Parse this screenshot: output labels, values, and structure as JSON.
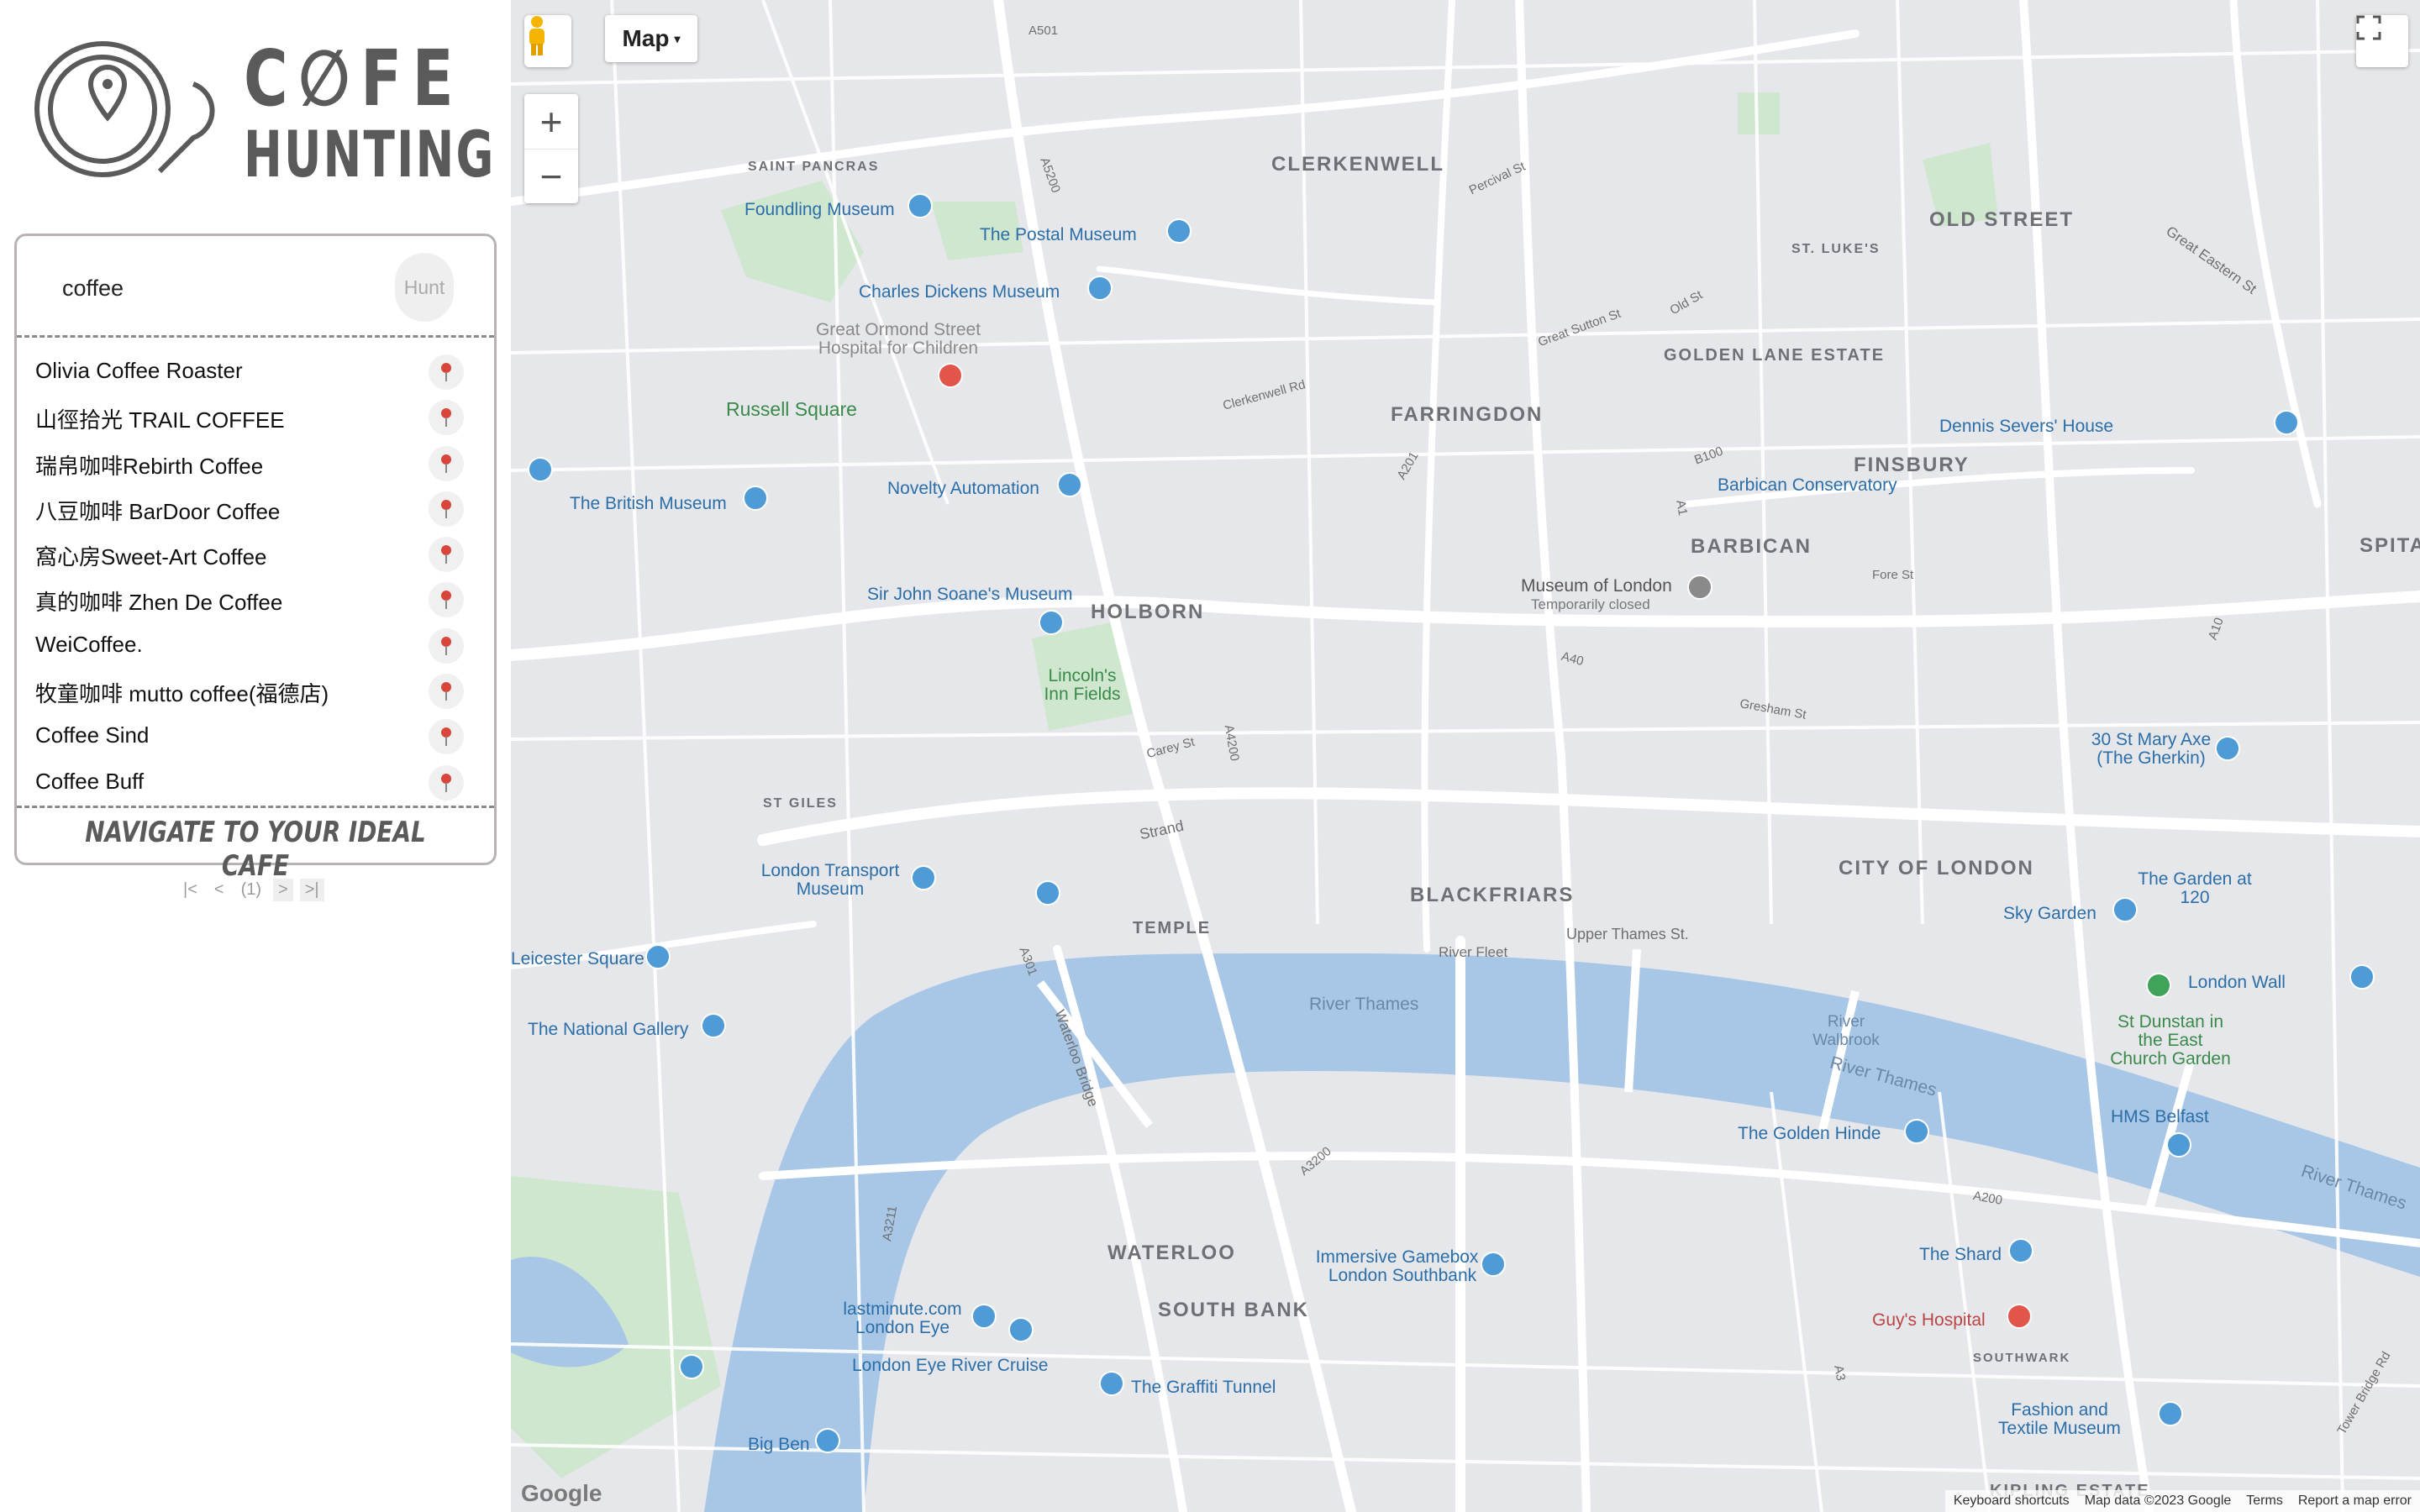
{
  "app": {
    "logo_line1": "C∅FE",
    "logo_line2": "HUNTING",
    "tagline": "NAVIGATE TO YOUR IDEAL CAFE"
  },
  "search": {
    "value": "coffee",
    "button_label": "Hunt"
  },
  "results": [
    "Olivia Coffee Roaster",
    "山徑拾光 TRAIL COFFEE",
    "瑞帛咖啡Rebirth Coffee",
    "八豆咖啡 BarDoor Coffee",
    "窩心房Sweet-Art Coffee",
    "真的咖啡 Zhen De Coffee",
    "WeiCoffee.",
    "牧童咖啡 mutto coffee(福德店)",
    "Coffee Sind",
    "Coffee Buff"
  ],
  "pager": {
    "first": "|<",
    "prev": "<",
    "current": "(1)",
    "next": ">",
    "last": ">|"
  },
  "map": {
    "type_label": "Map",
    "zoom_in": "+",
    "zoom_out": "−",
    "google_logo": "Google",
    "attribution": [
      "Keyboard shortcuts",
      "Map data ©2023 Google",
      "Terms",
      "Report a map error"
    ],
    "areas": [
      "CLERKENWELL",
      "FARRINGDON",
      "OLD STREET",
      "GOLDEN LANE ESTATE",
      "FINSBURY",
      "BARBICAN",
      "HOLBORN",
      "CITY OF LONDON",
      "BLACKFRIARS",
      "TEMPLE",
      "WATERLOO",
      "SOUTH BANK",
      "ST GILES",
      "SAINT PANCRAS",
      "SPITALFIELDS",
      "ST. LUKE'S",
      "SOUTHWARK",
      "KIPLING ESTATE"
    ],
    "pois": [
      "Foundling Museum",
      "The Postal Museum",
      "Charles Dickens Museum",
      "Great Ormond Street Hospital for Children",
      "Russell Square",
      "The British Museum",
      "Novelty Automation",
      "Sir John Soane's Museum",
      "Lincoln's Inn Fields",
      "Museum of London",
      "Temporarily closed",
      "Barbican Conservatory",
      "Dennis Severs' House",
      "30 St Mary Axe (The Gherkin)",
      "The Garden at 120",
      "Sky Garden",
      "London Wall",
      "St Dunstan in the East Church Garden",
      "HMS Belfast",
      "The Golden Hinde",
      "The Shard",
      "Guy's Hospital",
      "Fashion and Textile Museum",
      "Immersive Gamebox - London Southbank",
      "lastminute.com London Eye",
      "London Eye River Cruise",
      "The Graffiti Tunnel",
      "Big Ben",
      "London Transport Museum",
      "The National Gallery",
      "Leicester Square",
      "River Walbrook"
    ],
    "rivers": [
      "River Thames",
      "River Thames",
      "River Thames",
      "River Fleet"
    ],
    "roads": [
      "A501",
      "A5200",
      "A4200",
      "A3200",
      "A40",
      "A201",
      "A1",
      "A10",
      "A3211",
      "A301",
      "A3",
      "A200",
      "B100",
      "Strand",
      "Upper Thames St.",
      "Clerkenwell Rd",
      "Percival St",
      "Great Sutton St",
      "Old St",
      "Carey St",
      "Waterloo Bridge",
      "Tower Bridge Rd",
      "Great Eastern St",
      "Fore St",
      "Gresham St"
    ]
  }
}
